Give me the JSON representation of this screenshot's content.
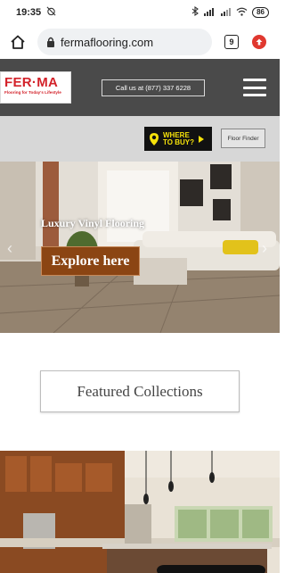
{
  "status_bar": {
    "time": "19:35",
    "battery": "86"
  },
  "browser": {
    "url": "fermaflooring.com",
    "tab_count": "9"
  },
  "header": {
    "logo_main": "FER·MA",
    "logo_tagline": "Flooring for Today's Lifestyle",
    "call_label": "Call us at (877) 337 6228"
  },
  "subheader": {
    "where_line1": "WHERE",
    "where_line2": "TO BUY?",
    "floor_finder": "Floor Finder"
  },
  "hero": {
    "title": "Luxury Vinyl Flooring",
    "cta": "Explore here"
  },
  "featured": {
    "label": "Featured Collections"
  },
  "colors": {
    "header_bg": "#4a4a4a",
    "brand_red": "#d3222a",
    "where_yellow": "#f5e10a",
    "cta_brown": "#8b4513"
  }
}
